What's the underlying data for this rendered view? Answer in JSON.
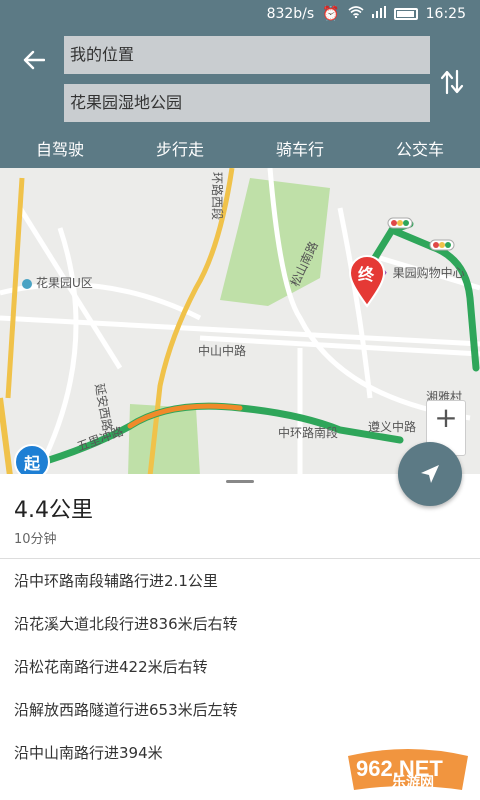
{
  "status_bar": {
    "network_speed": "832b/s",
    "time": "16:25",
    "icons": [
      "alarm-icon",
      "wifi-icon",
      "signal-icon",
      "battery-icon"
    ]
  },
  "header": {
    "from_value": "我的位置",
    "to_value": "花果园湿地公园",
    "modes": [
      "自驾驶",
      "步行走",
      "骑车行",
      "公交车"
    ]
  },
  "map": {
    "labels": {
      "huaguoyuan_u": "花果园U区",
      "songshan_road": "松山南路",
      "zhongshan_road": "中山中路",
      "huanlu_west": "环路西段",
      "yan_road": "延安西路",
      "zhonghuan_south": "中环路南段",
      "zunyi_road": "遵义中路",
      "wuli_road": "五里冲路",
      "shopping_center": "果园购物中心",
      "xiangya": "湘雅村"
    },
    "start_label": "起",
    "end_label": "终",
    "colors": {
      "route_green": "#2fa65a",
      "road_yellow": "#f0c24a",
      "park_green": "#bfe0a8"
    }
  },
  "summary": {
    "distance": "4.4公里",
    "duration": "10分钟"
  },
  "steps": [
    "沿中环路南段辅路行进2.1公里",
    "沿花溪大道北段行进836米后右转",
    "沿松花南路行进422米后右转",
    "沿解放西路隧道行进653米后左转",
    "沿中山南路行进394米"
  ],
  "watermark": {
    "text": "乐游网"
  }
}
